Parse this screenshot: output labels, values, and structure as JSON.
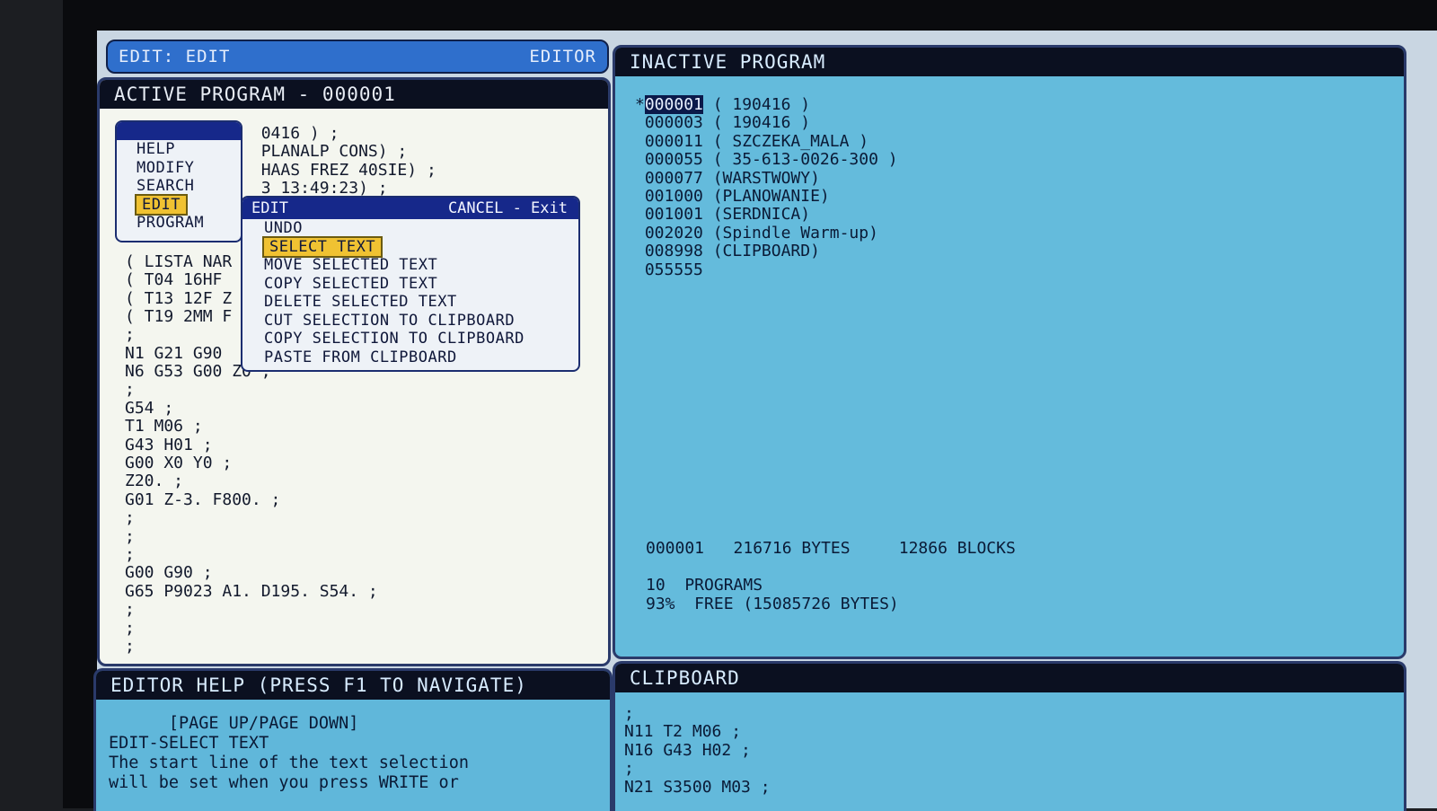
{
  "edit_bar": {
    "left": "EDIT: EDIT",
    "right": "EDITOR"
  },
  "active": {
    "title": "ACTIVE PROGRAM - 000001",
    "lines": [
      "              0416 ) ;",
      "              PLANALP CONS) ;",
      "              HAAS FREZ 40SIE) ;",
      "              3 13:49:23) ;",
      "",
      "",
      "",
      "( LISTA NAR",
      "( T04 16HF",
      "( T13 12F Z",
      "( T19 2MM F",
      ";",
      "N1 G21 G90",
      "N6 G53 G00 Z0 ;",
      ";",
      "G54 ;",
      "T1 M06 ;",
      "G43 H01 ;",
      "G00 X0 Y0 ;",
      "Z20. ;",
      "G01 Z-3. F800. ;",
      ";",
      ";",
      ";",
      "G00 G90 ;",
      "G65 P9023 A1. D195. S54. ;",
      ";",
      ";",
      ";"
    ]
  },
  "prog_menu": {
    "items": [
      "HELP",
      "MODIFY",
      "SEARCH",
      "EDIT",
      "PROGRAM"
    ],
    "selected": "EDIT"
  },
  "edit_menu": {
    "title": "EDIT",
    "cancel_hint": "CANCEL - Exit",
    "items": [
      "UNDO",
      "SELECT TEXT",
      "MOVE SELECTED TEXT",
      "COPY SELECTED TEXT",
      "DELETE SELECTED TEXT",
      "CUT SELECTION TO CLIPBOARD",
      "COPY SELECTION TO CLIPBOARD",
      "PASTE FROM CLIPBOARD"
    ],
    "selected": "SELECT TEXT"
  },
  "inactive": {
    "title": "INACTIVE PROGRAM",
    "programs": [
      {
        "marker": "*",
        "id": "000001",
        "comment": "( 190416 )"
      },
      {
        "marker": " ",
        "id": "000003",
        "comment": "( 190416 )"
      },
      {
        "marker": " ",
        "id": "000011",
        "comment": "( SZCZEKA_MALA )"
      },
      {
        "marker": " ",
        "id": "000055",
        "comment": "( 35-613-0026-300 )"
      },
      {
        "marker": " ",
        "id": "000077",
        "comment": "(WARSTWOWY)"
      },
      {
        "marker": " ",
        "id": "001000",
        "comment": "(PLANOWANIE)"
      },
      {
        "marker": " ",
        "id": "001001",
        "comment": "(SERDNICA)"
      },
      {
        "marker": " ",
        "id": "002020",
        "comment": "(Spindle Warm-up)"
      },
      {
        "marker": " ",
        "id": "008998",
        "comment": "(CLIPBOARD)"
      },
      {
        "marker": " ",
        "id": "055555",
        "comment": ""
      }
    ],
    "stats_line": "000001   216716 BYTES     12866 BLOCKS",
    "programs_line": "10  PROGRAMS",
    "free_line": "93%  FREE (15085726 BYTES)"
  },
  "help": {
    "title": "EDITOR HELP (PRESS F1 TO NAVIGATE)",
    "lines": [
      "      [PAGE UP/PAGE DOWN]",
      "EDIT-SELECT TEXT",
      "The start line of the text selection",
      "will be set when you press WRITE or"
    ]
  },
  "clipboard": {
    "title": "CLIPBOARD",
    "lines": [
      ";",
      "N11 T2 M06 ;",
      "N16 G43 H02 ;",
      ";",
      "N21 S3500 M03 ;"
    ]
  }
}
